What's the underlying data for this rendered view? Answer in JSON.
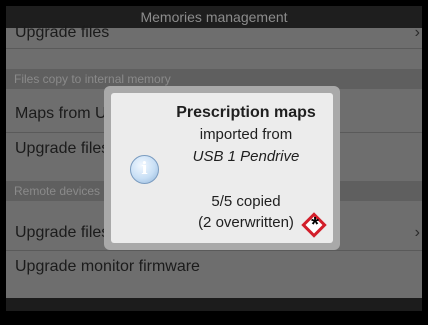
{
  "window": {
    "title": "Memories management"
  },
  "list": {
    "top_item": "Upgrade files",
    "section_internal": "Files copy to internal memory",
    "maps_item": "Maps from USB",
    "upgrade_files_item": "Upgrade files",
    "section_remote": "Remote devices",
    "remote_upgrade_item": "Upgrade files",
    "monitor_item": "Upgrade monitor firmware",
    "chevron": "›"
  },
  "dialog": {
    "title": "Prescription maps",
    "line_imported": "imported from",
    "source": "USB 1 Pendrive",
    "count": "5/5 copied",
    "overwritten": "(2 overwritten)"
  },
  "marker": {
    "symbol": "*",
    "color": "#d21e2a"
  },
  "icons": {
    "info": "info-icon",
    "chevron": "chevron-right-icon"
  }
}
